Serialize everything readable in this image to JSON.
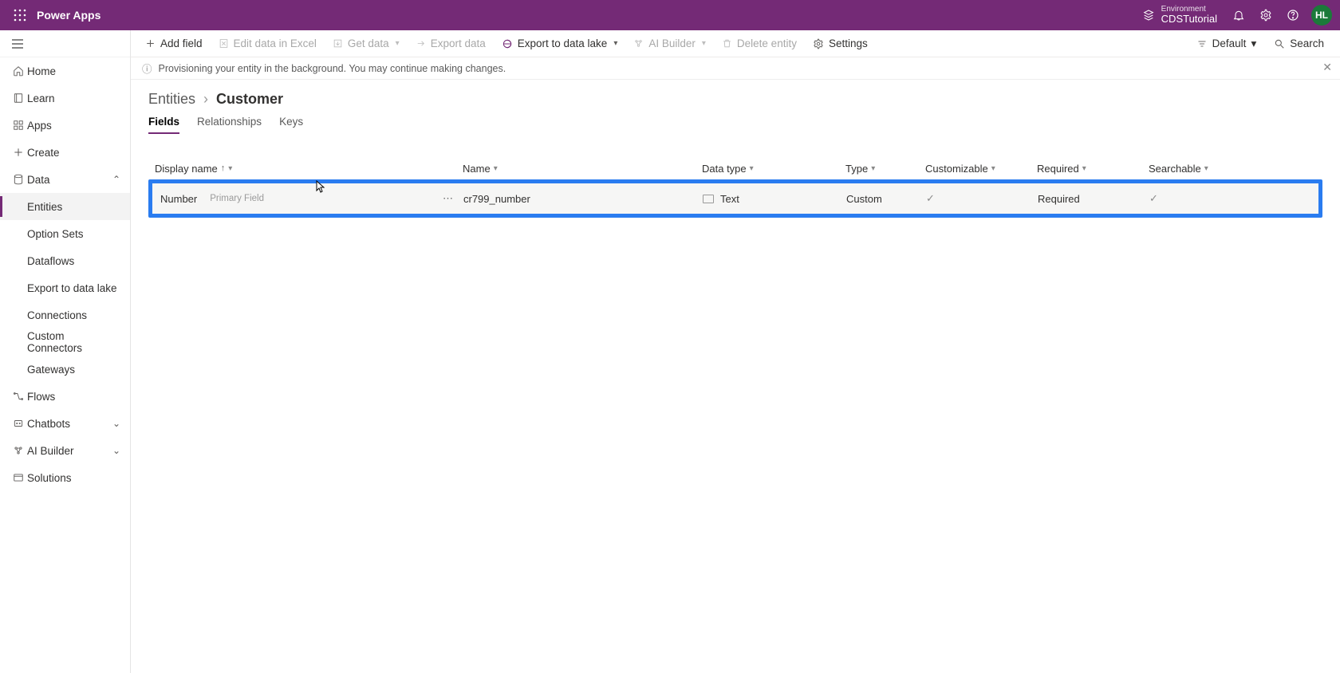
{
  "header": {
    "brand": "Power Apps",
    "env_label": "Environment",
    "env_value": "CDSTutorial",
    "avatar": "HL"
  },
  "sidebar": {
    "home": "Home",
    "learn": "Learn",
    "apps": "Apps",
    "create": "Create",
    "data": "Data",
    "entities": "Entities",
    "option_sets": "Option Sets",
    "dataflows": "Dataflows",
    "export_lake": "Export to data lake",
    "connections": "Connections",
    "custom_conn": "Custom Connectors",
    "gateways": "Gateways",
    "flows": "Flows",
    "chatbots": "Chatbots",
    "ai_builder": "AI Builder",
    "solutions": "Solutions"
  },
  "cmdbar": {
    "add_field": "Add field",
    "edit_excel": "Edit data in Excel",
    "get_data": "Get data",
    "export_data": "Export data",
    "export_lake": "Export to data lake",
    "ai_builder": "AI Builder",
    "delete_entity": "Delete entity",
    "settings": "Settings",
    "view": "Default",
    "search": "Search"
  },
  "info": {
    "msg": "Provisioning your entity in the background. You may continue making changes."
  },
  "breadcrumb": {
    "parent": "Entities",
    "current": "Customer"
  },
  "tabs": {
    "fields": "Fields",
    "relationships": "Relationships",
    "keys": "Keys"
  },
  "columns": {
    "display_name": "Display name",
    "name": "Name",
    "data_type": "Data type",
    "type": "Type",
    "customizable": "Customizable",
    "required": "Required",
    "searchable": "Searchable"
  },
  "row": {
    "display_name": "Number",
    "badge": "Primary Field",
    "name": "cr799_number",
    "data_type": "Text",
    "type": "Custom",
    "required": "Required"
  }
}
